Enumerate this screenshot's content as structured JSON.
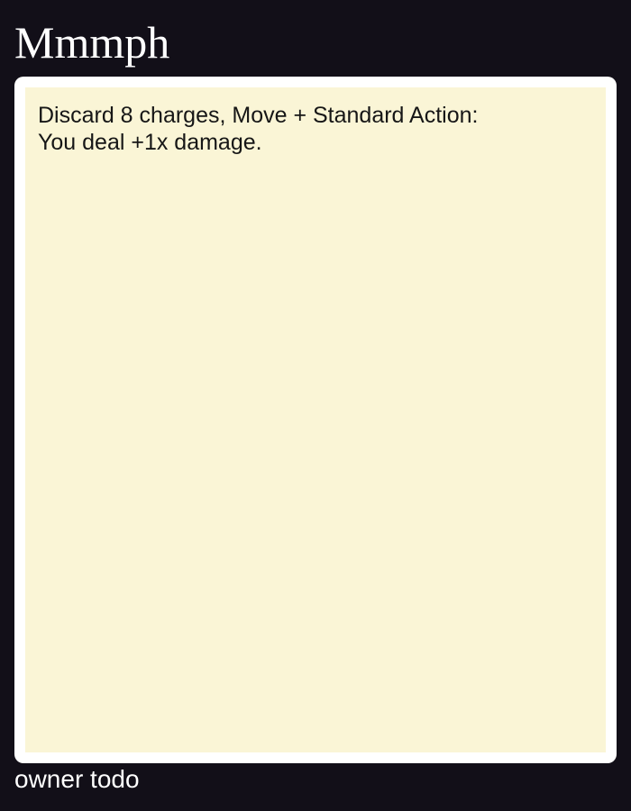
{
  "card": {
    "title": "Mmmph",
    "ability": {
      "cost_line": "Discard 8 charges, Move + Standard Action:",
      "effect_line": "You deal +1x damage."
    },
    "owner": "owner todo"
  },
  "colors": {
    "background": "#120f18",
    "frame": "#ffffff",
    "panel": "#faf5d6",
    "title_text": "#ffffff",
    "body_text": "#161616"
  }
}
